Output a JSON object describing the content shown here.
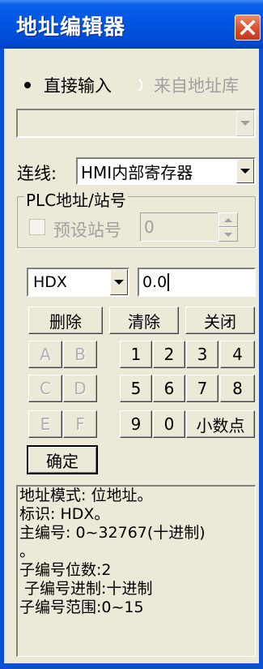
{
  "window": {
    "title": "地址编辑器",
    "close_icon": "close-icon"
  },
  "source": {
    "direct_label": "直接输入",
    "library_label": "来自地址库",
    "selected": "直接输入"
  },
  "address_library_select": {
    "value": ""
  },
  "connection": {
    "label": "连线:",
    "value": "HMI内部寄存器"
  },
  "plc": {
    "group_label": "PLC地址/站号",
    "preset_station_label": "预设站号",
    "station_value": "0"
  },
  "address": {
    "type_value": "HDX",
    "input_value": "0.0"
  },
  "actions": {
    "delete": "删除",
    "clear": "清除",
    "close": "关闭",
    "ok": "确定"
  },
  "keypad": {
    "hex": [
      "A",
      "B",
      "C",
      "D",
      "E",
      "F"
    ],
    "digits": [
      "1",
      "2",
      "3",
      "4",
      "5",
      "6",
      "7",
      "8",
      "9",
      "0"
    ],
    "decimal_point": "小数点"
  },
  "info": {
    "lines": [
      "地址模式: 位地址。",
      "标识: HDX。",
      "主编号: 0~32767(十进制)",
      "。",
      "子编号位数:2",
      " 子编号进制:十进制",
      "子编号范围:0~15"
    ]
  },
  "colors": {
    "titlebar": "#0054e3",
    "close_button": "#d9482a",
    "window_bg": "#ece9d8",
    "disabled_text": "#a0a0a0"
  }
}
